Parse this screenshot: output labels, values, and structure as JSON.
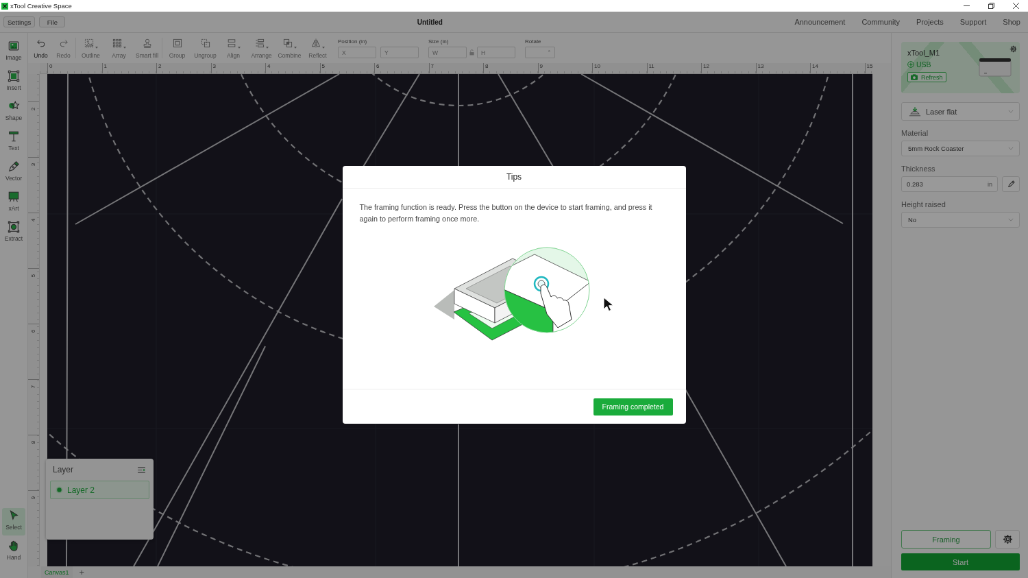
{
  "window": {
    "title": "xTool Creative Space"
  },
  "menu_bar": {
    "buttons": [
      "Settings",
      "File"
    ],
    "document_title": "Untitled",
    "links": [
      "Announcement",
      "Community",
      "Projects",
      "Support",
      "Shop"
    ]
  },
  "left_tools": [
    {
      "label": "Image",
      "selected": false
    },
    {
      "label": "Insert",
      "selected": false
    },
    {
      "label": "Shape",
      "selected": false
    },
    {
      "label": "Text",
      "selected": false
    },
    {
      "label": "Vector",
      "selected": false
    },
    {
      "label": "xArt",
      "selected": false
    },
    {
      "label": "Extract",
      "selected": false
    }
  ],
  "bottom_tools": [
    {
      "label": "Select",
      "selected": true
    },
    {
      "label": "Hand",
      "selected": false
    }
  ],
  "toolbar": {
    "groups": [
      {
        "items": [
          {
            "label": "Undo",
            "disabled": false,
            "menu": false
          },
          {
            "label": "Redo",
            "disabled": true,
            "menu": false
          }
        ]
      },
      {
        "items": [
          {
            "label": "Outline",
            "disabled": true,
            "menu": true
          },
          {
            "label": "Array",
            "disabled": true,
            "menu": true
          },
          {
            "label": "Smart fill",
            "disabled": true,
            "menu": false
          }
        ]
      },
      {
        "items": [
          {
            "label": "Group",
            "disabled": true,
            "menu": false
          },
          {
            "label": "Ungroup",
            "disabled": true,
            "menu": false
          },
          {
            "label": "Align",
            "disabled": true,
            "menu": true
          },
          {
            "label": "Arrange",
            "disabled": true,
            "menu": true
          },
          {
            "label": "Combine",
            "disabled": true,
            "menu": true
          },
          {
            "label": "Reflect",
            "disabled": true,
            "menu": true
          }
        ]
      }
    ],
    "transform": [
      {
        "label": "Position (in)",
        "inputs": [
          {
            "placeholder": "X"
          },
          {
            "placeholder": "Y"
          }
        ]
      },
      {
        "label": "Size (in)",
        "inputs": [
          {
            "placeholder": "W"
          },
          {
            "placeholder": "H"
          }
        ]
      },
      {
        "label": "Rotate",
        "inputs": [
          {
            "unit": "°"
          }
        ]
      }
    ]
  },
  "ruler": {
    "x_labels": [
      "0",
      "1",
      "2",
      "3",
      "4",
      "5",
      "6",
      "7",
      "8",
      "9",
      "10",
      "11",
      "12",
      "13",
      "14",
      "15"
    ],
    "y_labels": [
      "2",
      "3",
      "4",
      "5",
      "6",
      "7",
      "8",
      "9"
    ]
  },
  "canvas_tabs": {
    "tabs": [
      {
        "label": "Canvas1",
        "selected": true
      }
    ],
    "add": "+"
  },
  "layer_panel": {
    "title": "Layer",
    "layers": [
      {
        "name": "Layer 2",
        "selected": true
      }
    ]
  },
  "device_panel": {
    "device": {
      "name": "xTool_M1",
      "connection": "USB",
      "refresh": "Refresh"
    },
    "mode": "Laser flat",
    "fields": [
      {
        "kind": "select",
        "label": "Material",
        "value": "5mm Rock Coaster"
      },
      {
        "kind": "number",
        "label": "Thickness",
        "value": "0.283",
        "unit": "in"
      },
      {
        "kind": "select",
        "label": "Height raised",
        "value": "No"
      }
    ],
    "framing": "Framing",
    "start": "Start"
  },
  "dialog": {
    "title": "Tips",
    "message": "The framing function is ready. Press the button on the device to start framing, and press it again to perform framing once more.",
    "button": "Framing completed"
  }
}
